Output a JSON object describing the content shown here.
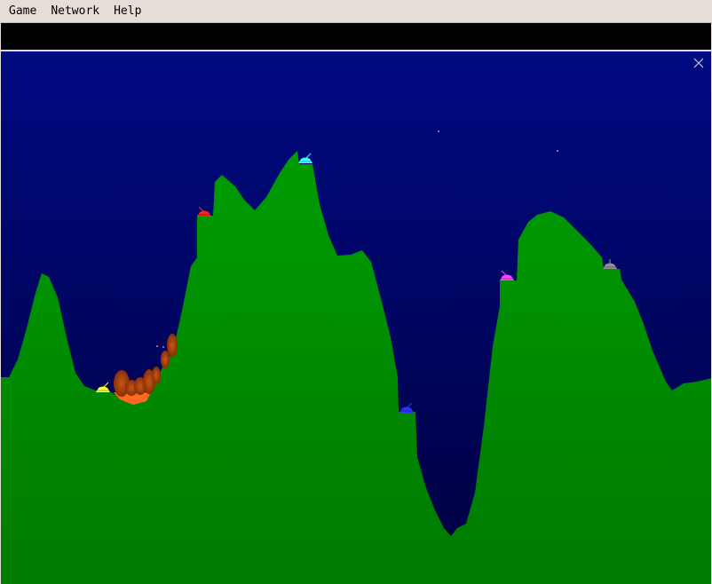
{
  "menu": {
    "items": [
      "Game",
      "Network",
      "Help"
    ]
  },
  "game": {
    "sky_top": "#000a82",
    "sky_bottom": "#000040",
    "ground_top": "#009c00",
    "ground_bottom": "#007a00",
    "tanks": [
      {
        "color": "#ffff40"
      },
      {
        "color": "#ff2020"
      },
      {
        "color": "#40ffff"
      },
      {
        "color": "#3030ff"
      },
      {
        "color": "#ff40ff"
      },
      {
        "color": "#909090"
      }
    ]
  }
}
